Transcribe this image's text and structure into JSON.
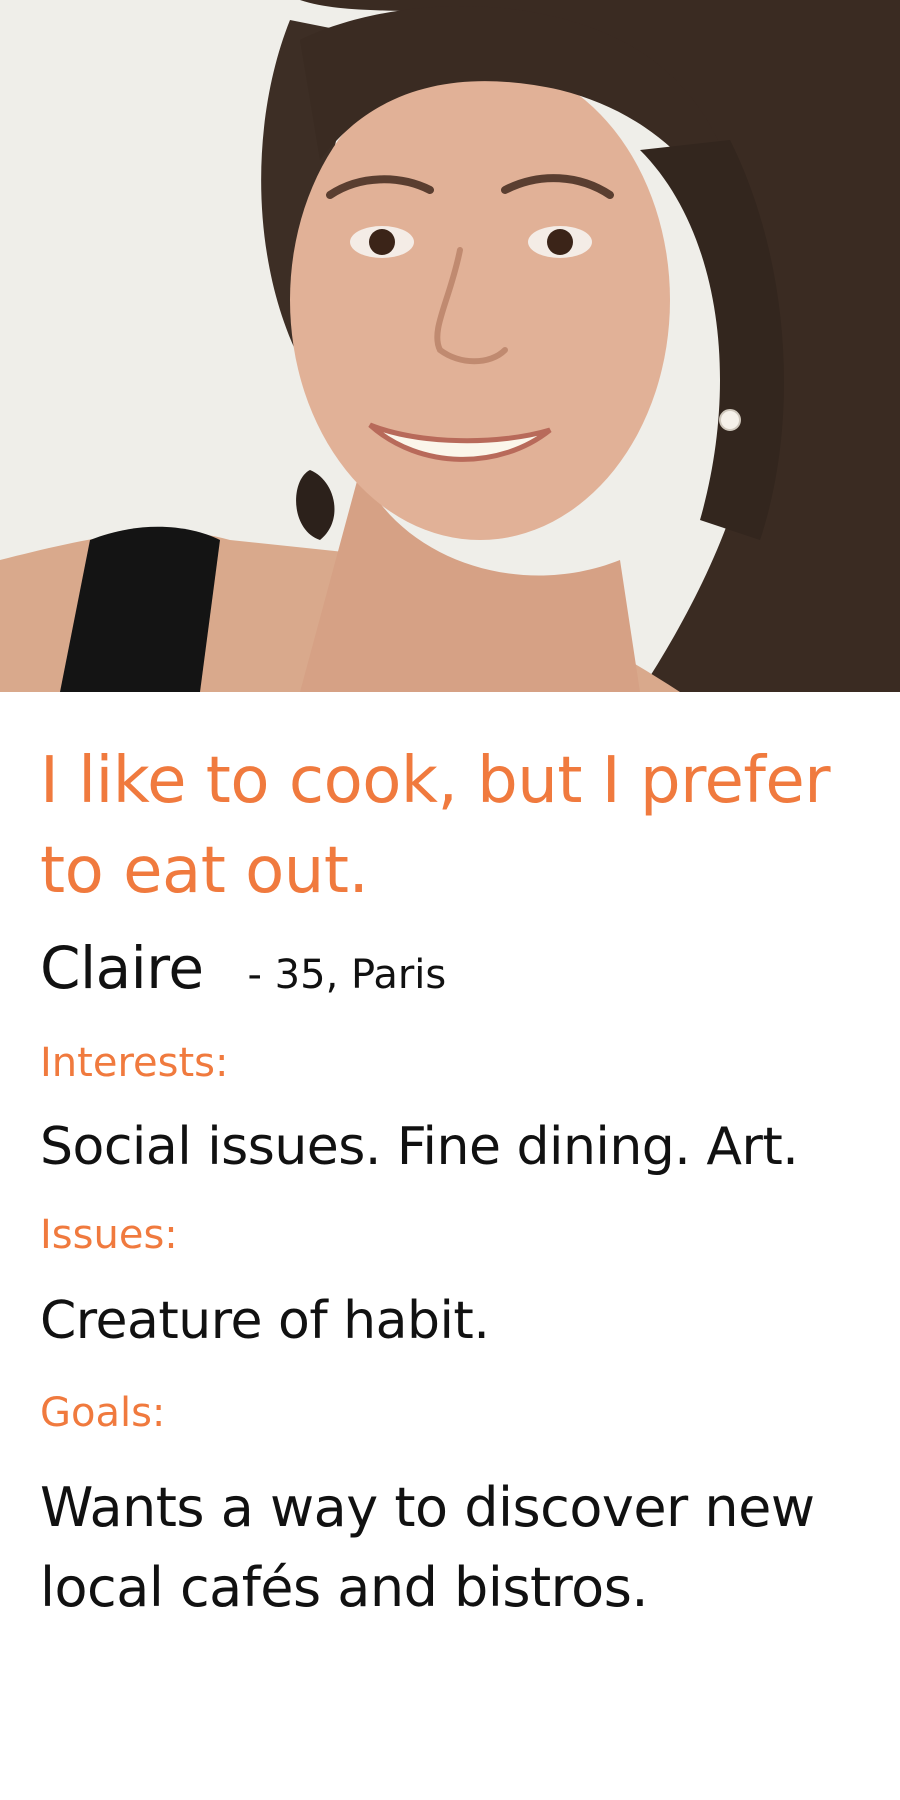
{
  "profile": {
    "quote": "I like to cook, but I prefer to eat out.",
    "name": "Claire",
    "meta": "- 35, Paris"
  },
  "sections": {
    "interests": {
      "label": "Interests:",
      "text": "Social issues. Fine dining. Art."
    },
    "issues": {
      "label": "Issues:",
      "text": "Creature of habit."
    },
    "goals": {
      "label": "Goals:",
      "text": "Wants a way to discover new local cafés and bistros."
    }
  },
  "colors": {
    "accent": "#f07a3e",
    "text": "#111111",
    "background": "#ffffff"
  }
}
